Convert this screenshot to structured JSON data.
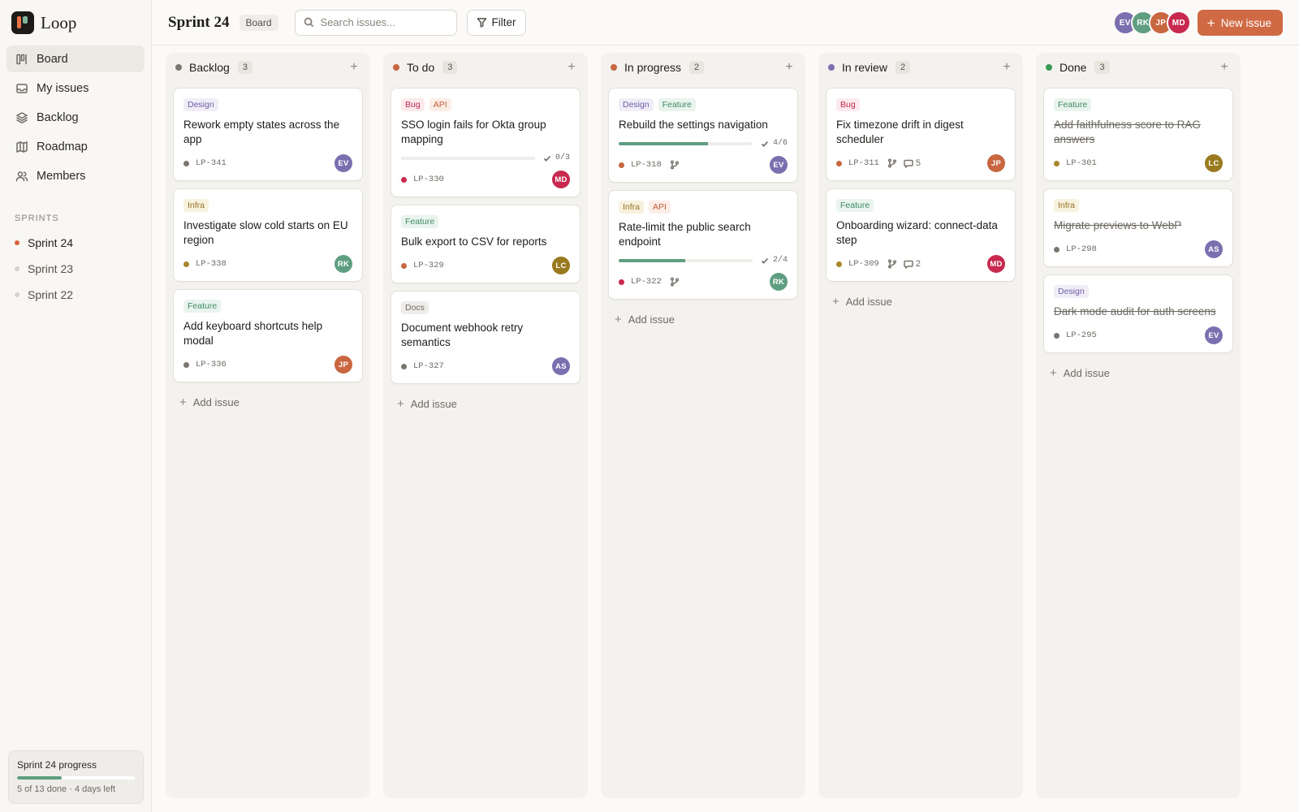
{
  "app": {
    "name": "Loop",
    "colors": {
      "accent": "#cf6a45",
      "progress": "#5f9e80"
    }
  },
  "sidebar": {
    "items": [
      {
        "label": "Board",
        "icon": "board-icon",
        "active": true
      },
      {
        "label": "My issues",
        "icon": "inbox-icon",
        "active": false
      },
      {
        "label": "Backlog",
        "icon": "layers-icon",
        "active": false
      },
      {
        "label": "Roadmap",
        "icon": "map-icon",
        "active": false
      },
      {
        "label": "Members",
        "icon": "users-icon",
        "active": false
      }
    ],
    "sprints_label": "SPRINTS",
    "sprints": [
      {
        "label": "Sprint 24",
        "active": true
      },
      {
        "label": "Sprint 23",
        "active": false
      },
      {
        "label": "Sprint 22",
        "active": false
      }
    ],
    "progress": {
      "title": "Sprint 24 progress",
      "fraction": 0.38,
      "meta": "5 of 13 done · 4 days left"
    }
  },
  "header": {
    "title": "Sprint 24",
    "view": "Board",
    "search_placeholder": "Search issues...",
    "filter_label": "Filter",
    "new_issue_label": "New issue",
    "members": [
      {
        "initials": "EV",
        "color": "#7b6fb0"
      },
      {
        "initials": "RK",
        "color": "#5f9e80"
      },
      {
        "initials": "JP",
        "color": "#c8663f"
      },
      {
        "initials": "MD",
        "color": "#c8294f"
      }
    ]
  },
  "board": {
    "add_issue_label": "Add issue",
    "columns": [
      {
        "title": "Backlog",
        "count": "3",
        "color": "#7a766f",
        "cards": [
          {
            "tags": [
              "Design"
            ],
            "title": "Rework empty states across the app",
            "id": "LP-341",
            "priority": "#7a766f",
            "assignee": "EV",
            "assignee_color": "#7b6fb0"
          },
          {
            "tags": [
              "Infra"
            ],
            "title": "Investigate slow cold starts on EU region",
            "id": "LP-338",
            "priority": "#a8862a",
            "assignee": "RK",
            "assignee_color": "#5f9e80"
          },
          {
            "tags": [
              "Feature"
            ],
            "title": "Add keyboard shortcuts help modal",
            "id": "LP-336",
            "priority": "#7a766f",
            "assignee": "JP",
            "assignee_color": "#c8663f"
          }
        ]
      },
      {
        "title": "To do",
        "count": "3",
        "color": "#c8663f",
        "cards": [
          {
            "tags": [
              "Bug",
              "API"
            ],
            "title": "SSO login fails for Okta group mapping",
            "subtasks": "0/3",
            "sub_fraction": 0,
            "id": "LP-330",
            "priority": "#c8294f",
            "assignee": "MD",
            "assignee_color": "#c8294f"
          },
          {
            "tags": [
              "Feature"
            ],
            "title": "Bulk export to CSV for reports",
            "id": "LP-329",
            "priority": "#c8663f",
            "assignee": "LC",
            "assignee_color": "#9a7a1e"
          },
          {
            "tags": [
              "Docs"
            ],
            "title": "Document webhook retry semantics",
            "id": "LP-327",
            "priority": "#7a766f",
            "assignee": "AS",
            "assignee_color": "#7b6fb0"
          }
        ]
      },
      {
        "title": "In progress",
        "count": "2",
        "color": "#c8663f",
        "cards": [
          {
            "tags": [
              "Design",
              "Feature"
            ],
            "title": "Rebuild the settings navigation",
            "subtasks": "4/6",
            "sub_fraction": 0.667,
            "id": "LP-318",
            "priority": "#c8663f",
            "branch": true,
            "assignee": "EV",
            "assignee_color": "#7b6fb0"
          },
          {
            "tags": [
              "Infra",
              "API"
            ],
            "title": "Rate-limit the public search endpoint",
            "subtasks": "2/4",
            "sub_fraction": 0.5,
            "id": "LP-322",
            "priority": "#c8294f",
            "branch": true,
            "assignee": "RK",
            "assignee_color": "#5f9e80"
          }
        ]
      },
      {
        "title": "In review",
        "count": "2",
        "color": "#7b6fb0",
        "cards": [
          {
            "tags": [
              "Bug"
            ],
            "title": "Fix timezone drift in digest scheduler",
            "id": "LP-311",
            "priority": "#c8663f",
            "branch": true,
            "comments": "5",
            "assignee": "JP",
            "assignee_color": "#c8663f"
          },
          {
            "tags": [
              "Feature"
            ],
            "title": "Onboarding wizard: connect-data step",
            "id": "LP-309",
            "priority": "#a8862a",
            "branch": true,
            "comments": "2",
            "assignee": "MD",
            "assignee_color": "#c8294f"
          }
        ]
      },
      {
        "title": "Done",
        "count": "3",
        "color": "#3a9a55",
        "done": true,
        "cards": [
          {
            "tags": [
              "Feature"
            ],
            "title": "Add faithfulness score to RAG answers",
            "id": "LP-301",
            "priority": "#a8862a",
            "assignee": "LC",
            "assignee_color": "#9a7a1e"
          },
          {
            "tags": [
              "Infra"
            ],
            "title": "Migrate previews to WebP",
            "id": "LP-298",
            "priority": "#7a766f",
            "assignee": "AS",
            "assignee_color": "#7b6fb0"
          },
          {
            "tags": [
              "Design"
            ],
            "title": "Dark mode audit for auth screens",
            "id": "LP-295",
            "priority": "#7a766f",
            "assignee": "EV",
            "assignee_color": "#7b6fb0"
          }
        ]
      }
    ]
  },
  "tag_styles": {
    "Design": {
      "bg": "#f0edf7",
      "fg": "#6d5fa8"
    },
    "Feature": {
      "bg": "#e9f4ee",
      "fg": "#3f8a63"
    },
    "Bug": {
      "bg": "#fbe9ee",
      "fg": "#c0294e"
    },
    "API": {
      "bg": "#fcede6",
      "fg": "#c2603a"
    },
    "Infra": {
      "bg": "#f8f1de",
      "fg": "#947424"
    },
    "Docs": {
      "bg": "#efede9",
      "fg": "#6e6a63"
    }
  }
}
